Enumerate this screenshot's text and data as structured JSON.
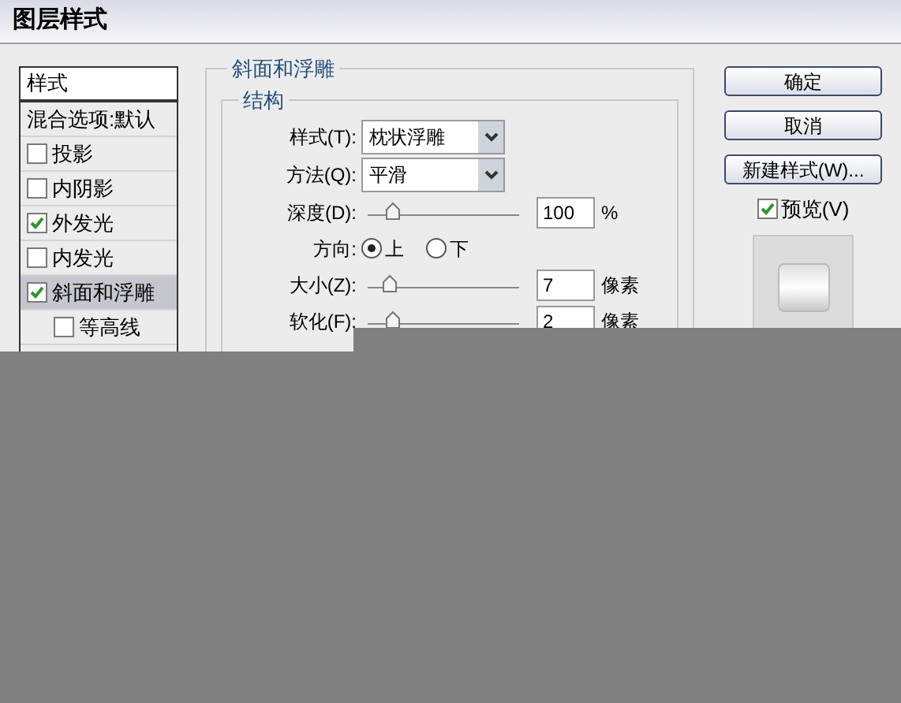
{
  "window": {
    "title": "图层样式"
  },
  "styles_list": {
    "header": "样式",
    "items": [
      {
        "kind": "plain",
        "label": "混合选项:默认",
        "selected": false
      },
      {
        "kind": "check",
        "label": "投影",
        "checked": false,
        "selected": false
      },
      {
        "kind": "check",
        "label": "内阴影",
        "checked": false,
        "selected": false
      },
      {
        "kind": "check",
        "label": "外发光",
        "checked": true,
        "selected": false
      },
      {
        "kind": "check",
        "label": "内发光",
        "checked": false,
        "selected": false
      },
      {
        "kind": "check",
        "label": "斜面和浮雕",
        "checked": true,
        "selected": true,
        "children": [
          {
            "kind": "check",
            "label": "等高线",
            "checked": false,
            "selected": false
          }
        ]
      }
    ]
  },
  "panel": {
    "title": "斜面和浮雕",
    "group": {
      "title": "结构",
      "rows": [
        {
          "kind": "select",
          "label": "样式(T):",
          "value": "枕状浮雕"
        },
        {
          "kind": "select",
          "label": "方法(Q):",
          "value": "平滑"
        },
        {
          "kind": "slider",
          "label": "深度(D):",
          "level": 0.08,
          "value": "100",
          "unit": "%"
        },
        {
          "kind": "radio",
          "label": "方向:",
          "options": [
            {
              "label": "上",
              "selected": true
            },
            {
              "label": "下",
              "selected": false
            }
          ]
        },
        {
          "kind": "slider",
          "label": "大小(Z):",
          "level": 0.06,
          "value": "7",
          "unit": "像素"
        },
        {
          "kind": "slider",
          "label": "软化(F):",
          "level": 0.08,
          "value": "2",
          "unit": "像素"
        }
      ]
    }
  },
  "buttons": [
    "确定",
    "取消",
    "新建样式(W)..."
  ],
  "preview": {
    "label": "预览(V)",
    "checked": true
  }
}
